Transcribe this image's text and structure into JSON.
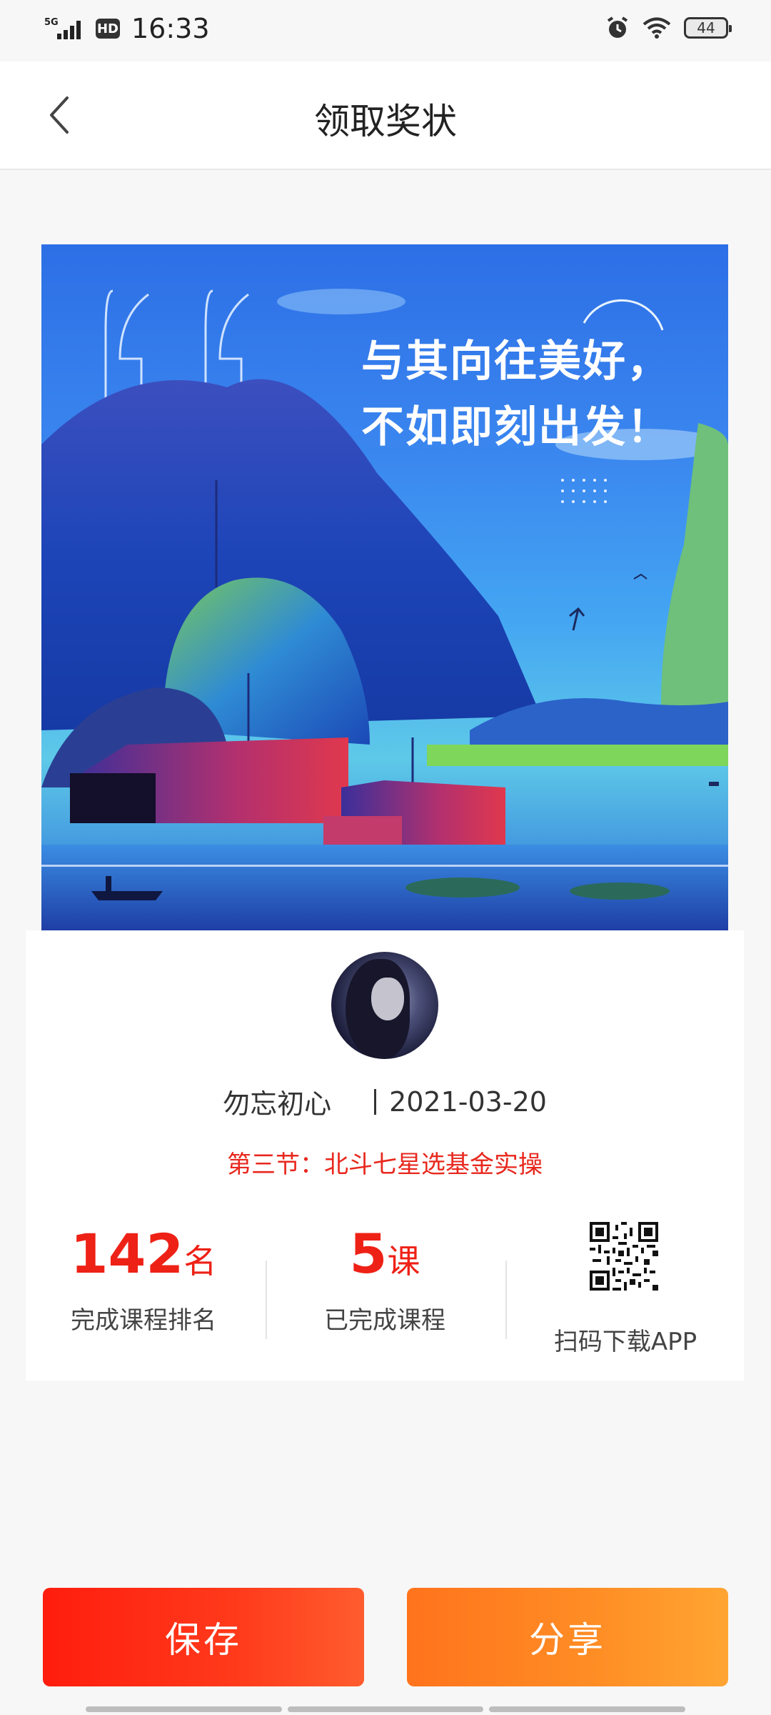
{
  "status_bar": {
    "network": "5G",
    "hd": "HD",
    "time": "16:33",
    "battery": "44"
  },
  "navbar": {
    "title": "领取奖状"
  },
  "poster": {
    "line1": "与其向往美好，",
    "line2": "不如即刻出发！"
  },
  "card": {
    "user_name": "勿忘初心",
    "date": "2021-03-20",
    "lesson": "第三节：北斗七星选基金实操",
    "stats": [
      {
        "value": "142",
        "unit": "名",
        "label": "完成课程排名"
      },
      {
        "value": "5",
        "unit": "课",
        "label": "已完成课程"
      }
    ],
    "qr_label": "扫码下载APP"
  },
  "buttons": {
    "save": "保存",
    "share": "分享"
  },
  "colors": {
    "accent_red": "#ee2116",
    "save_btn": "#ff2a12",
    "share_btn": "#ff8e25"
  }
}
